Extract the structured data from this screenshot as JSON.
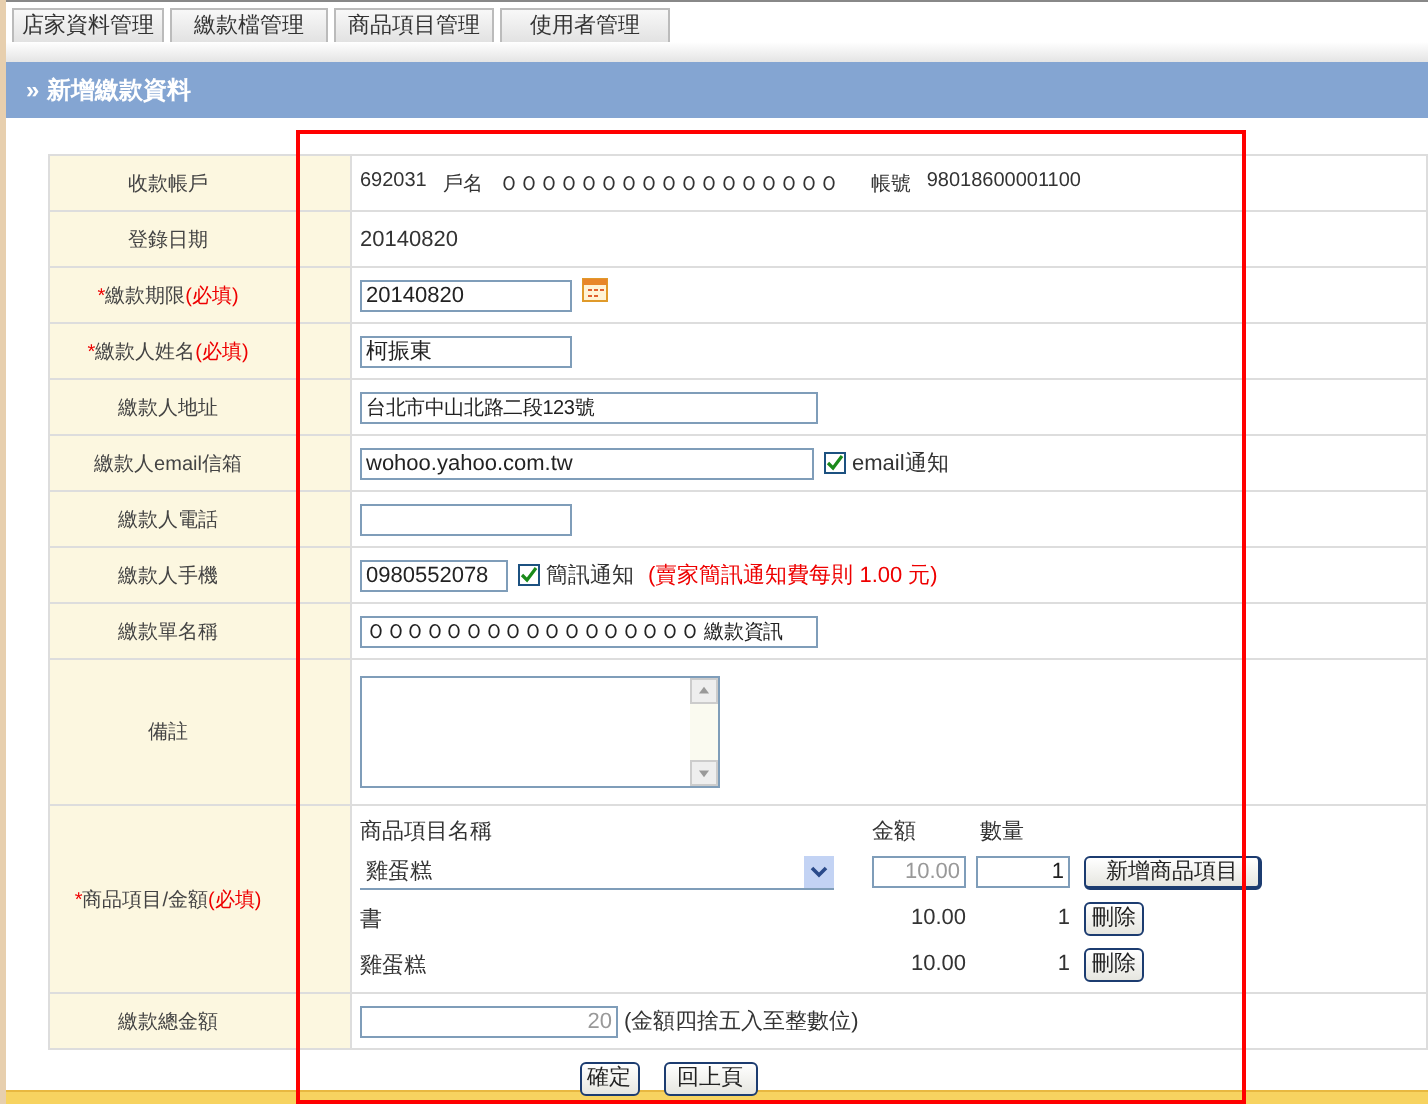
{
  "tabs": [
    {
      "label": "店家資料管理",
      "selected": false
    },
    {
      "label": "繳款檔管理",
      "selected": false
    },
    {
      "label": "商品項目管理",
      "selected": false
    },
    {
      "label": "使用者管理",
      "selected": false
    }
  ],
  "header": {
    "marker": "»",
    "title": "新增繳款資料"
  },
  "form": {
    "rows": [
      {
        "kind": "account",
        "label": "收款帳戶",
        "code": "692031",
        "name_label": "戶名",
        "name": "ＯＯＯＯＯＯＯＯＯＯＯＯＯＯＯＯＯ",
        "account_label": "帳號",
        "account": "98018600001100"
      },
      {
        "kind": "static",
        "label": "登錄日期",
        "value": "20140820"
      },
      {
        "kind": "date",
        "label": "繳款期限",
        "required": true,
        "marker": "*",
        "required_note": "(必填)",
        "value": "20140820"
      },
      {
        "kind": "input_short",
        "label": "繳款人姓名",
        "required": true,
        "marker": "*",
        "required_note": "(必填)",
        "value": "柯振東"
      },
      {
        "kind": "input_long",
        "label": "繳款人地址",
        "value": "台北市中山北路二段123號"
      },
      {
        "kind": "email",
        "label": "繳款人email信箱",
        "value": "wohoo.yahoo.com.tw",
        "check_label": "email通知",
        "checked": true
      },
      {
        "kind": "input_short",
        "label": "繳款人電話",
        "placeholder": ""
      },
      {
        "kind": "mobile",
        "label": "繳款人手機",
        "value": "0980552078",
        "check_label": "簡訊通知",
        "checked": true,
        "note": "(賣家簡訊通知費每則 1.00 元)"
      },
      {
        "kind": "input_long",
        "label": "繳款單名稱",
        "value": "ＯＯＯＯＯＯＯＯＯＯＯＯＯＯＯＯＯ 繳款資訊"
      },
      {
        "kind": "textarea",
        "label": "備註"
      },
      {
        "kind": "items",
        "label": "商品項目/金額",
        "required": true,
        "marker": "*",
        "required_note": "(必填)",
        "name_header": "商品項目名稱",
        "amount_header": "金額",
        "qty_header": "數量",
        "select_value": "雞蛋糕",
        "amount_value": "10.00",
        "amount_disabled": true,
        "qty_value": "1",
        "add_button": "新增商品項目",
        "lines": [
          {
            "name": "書",
            "amount": "10.00",
            "qty": "1",
            "delete_button": "刪除"
          },
          {
            "name": "雞蛋糕",
            "amount": "10.00",
            "qty": "1",
            "delete_button": "刪除"
          }
        ]
      },
      {
        "kind": "total",
        "label": "繳款總金額",
        "value": "20",
        "disabled": true,
        "note": "(金額四捨五入至整數位)"
      }
    ]
  },
  "buttons": [
    "確定",
    "回上頁"
  ]
}
